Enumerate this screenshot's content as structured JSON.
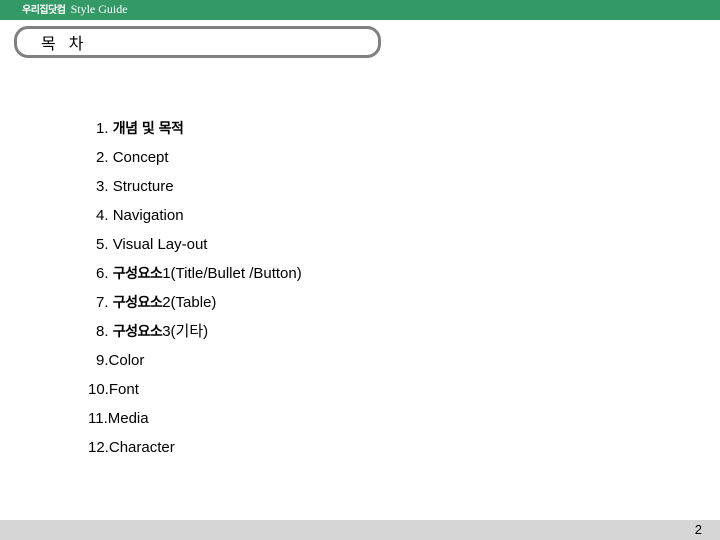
{
  "header": {
    "title_korean": "우리집닷컴",
    "title_english": "Style Guide",
    "background_color": "#339966",
    "text_color": "#ffffff"
  },
  "title_box": {
    "title": "목 차",
    "border_color": "#808080"
  },
  "toc": {
    "items": [
      {
        "num": "1. ",
        "ko": "개념 및 목적",
        "rest": ""
      },
      {
        "num": "2. ",
        "ko": "",
        "rest": "Concept"
      },
      {
        "num": "3. ",
        "ko": "",
        "rest": "Structure"
      },
      {
        "num": "4. ",
        "ko": "",
        "rest": "Navigation"
      },
      {
        "num": "5. ",
        "ko": "",
        "rest": "Visual Lay-out"
      },
      {
        "num": "6. ",
        "ko": "구성요소",
        "rest": "1(Title/Bullet /Button)"
      },
      {
        "num": "7. ",
        "ko": "구성요소",
        "rest": "2(Table)"
      },
      {
        "num": "8. ",
        "ko": "구성요소",
        "rest": "3(기타)"
      },
      {
        "num": "9.",
        "ko": "",
        "rest": "Color"
      },
      {
        "num": "10.",
        "ko": "",
        "rest": "Font"
      },
      {
        "num": "11.",
        "ko": "",
        "rest": "Media"
      },
      {
        "num": "12.",
        "ko": "",
        "rest": "Character"
      }
    ]
  },
  "footer": {
    "page_number": "2",
    "background_color": "#d6d6d6"
  }
}
